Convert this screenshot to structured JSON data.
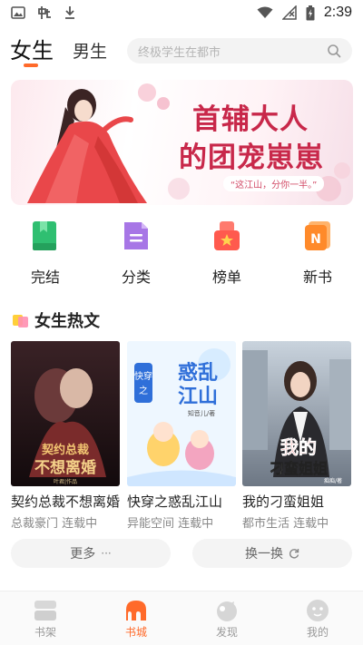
{
  "status_bar": {
    "time": "2:39"
  },
  "header": {
    "tabs": [
      {
        "label": "女生",
        "active": true
      },
      {
        "label": "男生",
        "active": false
      }
    ],
    "search": {
      "placeholder": "终极学生在都市"
    }
  },
  "banner": {
    "title_line1": "首辅大人",
    "title_line2": "的团宠崽崽",
    "subtitle": "“这江山，分你一半。”"
  },
  "entries": [
    {
      "label": "完结",
      "icon": "book-icon",
      "color": "#2fbf71"
    },
    {
      "label": "分类",
      "icon": "category-icon",
      "color": "#a776e6"
    },
    {
      "label": "榜单",
      "icon": "ranking-icon",
      "color": "#ff5a4e"
    },
    {
      "label": "新书",
      "icon": "new-book-icon",
      "color": "#ff8a2a"
    }
  ],
  "section": {
    "title": "女生热文"
  },
  "books": [
    {
      "title": "契约总裁不想离婚",
      "meta": "总裁豪门 连载中",
      "cover_text": "契约总裁\n不想离婚",
      "cover_author": "叶君|作品"
    },
    {
      "title": "快穿之惑乱江山",
      "meta": "异能空间 连载中",
      "cover_text": "惑乱江山",
      "cover_tag": "快穿之",
      "cover_author": "知音儿/著"
    },
    {
      "title": "我的刁蛮姐姐",
      "meta": "都市生活 连载中",
      "cover_text": "我的刁蛮姐姐",
      "cover_author": "痴痴/著"
    }
  ],
  "actions": {
    "more": "更多",
    "swap": "换一换"
  },
  "bottom_nav": [
    {
      "label": "书架",
      "active": false
    },
    {
      "label": "书城",
      "active": true
    },
    {
      "label": "发现",
      "active": false
    },
    {
      "label": "我的",
      "active": false
    }
  ],
  "colors": {
    "accent": "#ff6a2a",
    "banner_title": "#c8284a"
  }
}
